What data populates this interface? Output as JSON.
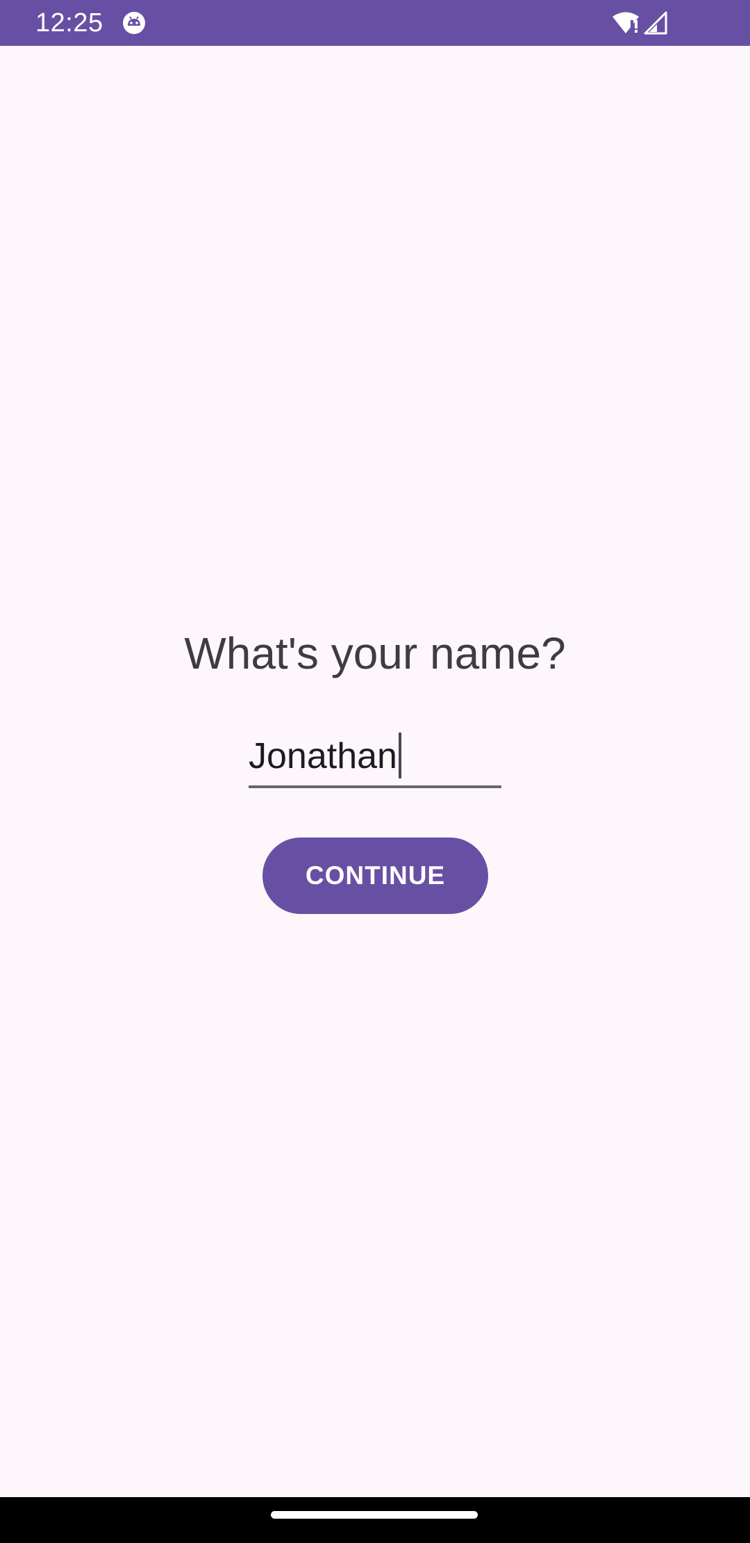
{
  "status_bar": {
    "time": "12:25",
    "background_color": "#6750A4",
    "icons": [
      "android-app-icon",
      "wifi-icon",
      "signal-icon"
    ]
  },
  "main": {
    "question": "What's your name?",
    "name_input": {
      "value": "Jonathan",
      "placeholder": ""
    },
    "continue_label": "CONTINUE"
  },
  "colors": {
    "accent": "#6750A4",
    "background": "#FDF7FC",
    "text": "#3F3A43"
  }
}
